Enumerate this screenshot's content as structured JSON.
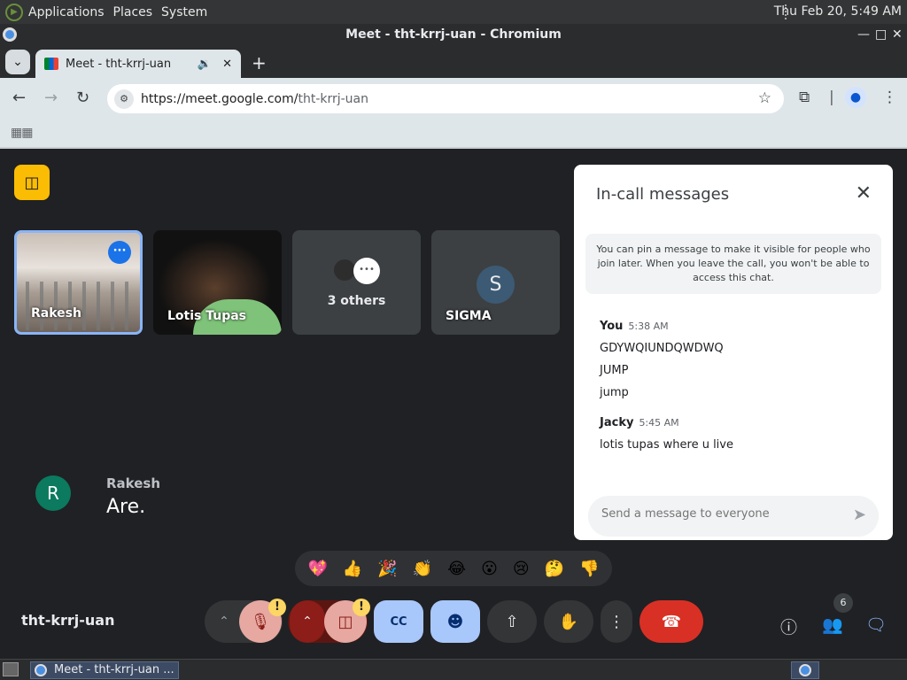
{
  "os_panel": {
    "menu": [
      "Applications",
      "Places",
      "System"
    ],
    "clock": "Thu Feb 20,  5:49 AM"
  },
  "window": {
    "title": "Meet - tht-krrj-uan - Chromium",
    "controls": [
      "—",
      "□",
      "✕"
    ]
  },
  "tab": {
    "title": "Meet - tht-krrj-uan",
    "audio_icon": "🔉",
    "close": "✕",
    "new_tab": "+"
  },
  "toolbar": {
    "url_host": "https://meet.google.com/",
    "url_path": "tht-krrj-uan",
    "back": "←",
    "forward": "→",
    "reload": "↻",
    "star": "☆",
    "extensions": "⧉",
    "menu": "⋮"
  },
  "participants": [
    {
      "name": "Rakesh"
    },
    {
      "name": "Lotis Tupas"
    },
    {
      "name": "3 others"
    },
    {
      "name": "SIGMA",
      "initial": "S"
    }
  ],
  "caption": {
    "initial": "R",
    "speaker": "Rakesh",
    "text": "Are."
  },
  "chat": {
    "header": "In-call messages",
    "notice": "You can pin a message to make it visible for people who join later. When you leave the call, you won't be able to access this chat.",
    "groups": [
      {
        "sender": "You",
        "time": "5:38 AM",
        "lines": [
          "GDYWQIUNDQWDWQ",
          "JUMP",
          "jump"
        ]
      },
      {
        "sender": "Jacky",
        "time": "5:45 AM",
        "lines": [
          "lotis tupas where u live"
        ]
      }
    ],
    "placeholder": "Send a message to everyone"
  },
  "reactions": [
    "💖",
    "👍",
    "🎉",
    "👏",
    "😂",
    "😮",
    "😢",
    "🤔",
    "👎"
  ],
  "meeting_code": "tht-krrj-uan",
  "controls": {
    "warn_mark": "!",
    "people_count": "6"
  },
  "taskbar": {
    "item": "Meet - tht-krrj-uan ..."
  },
  "colors": {
    "hangup": "#d93025",
    "active_blue": "#a8c7fa",
    "mic_bg": "#e6a8a1",
    "cam_bg": "#8c1d18",
    "companion": "#fbbc04",
    "tile_border": "#8ab4f8"
  }
}
